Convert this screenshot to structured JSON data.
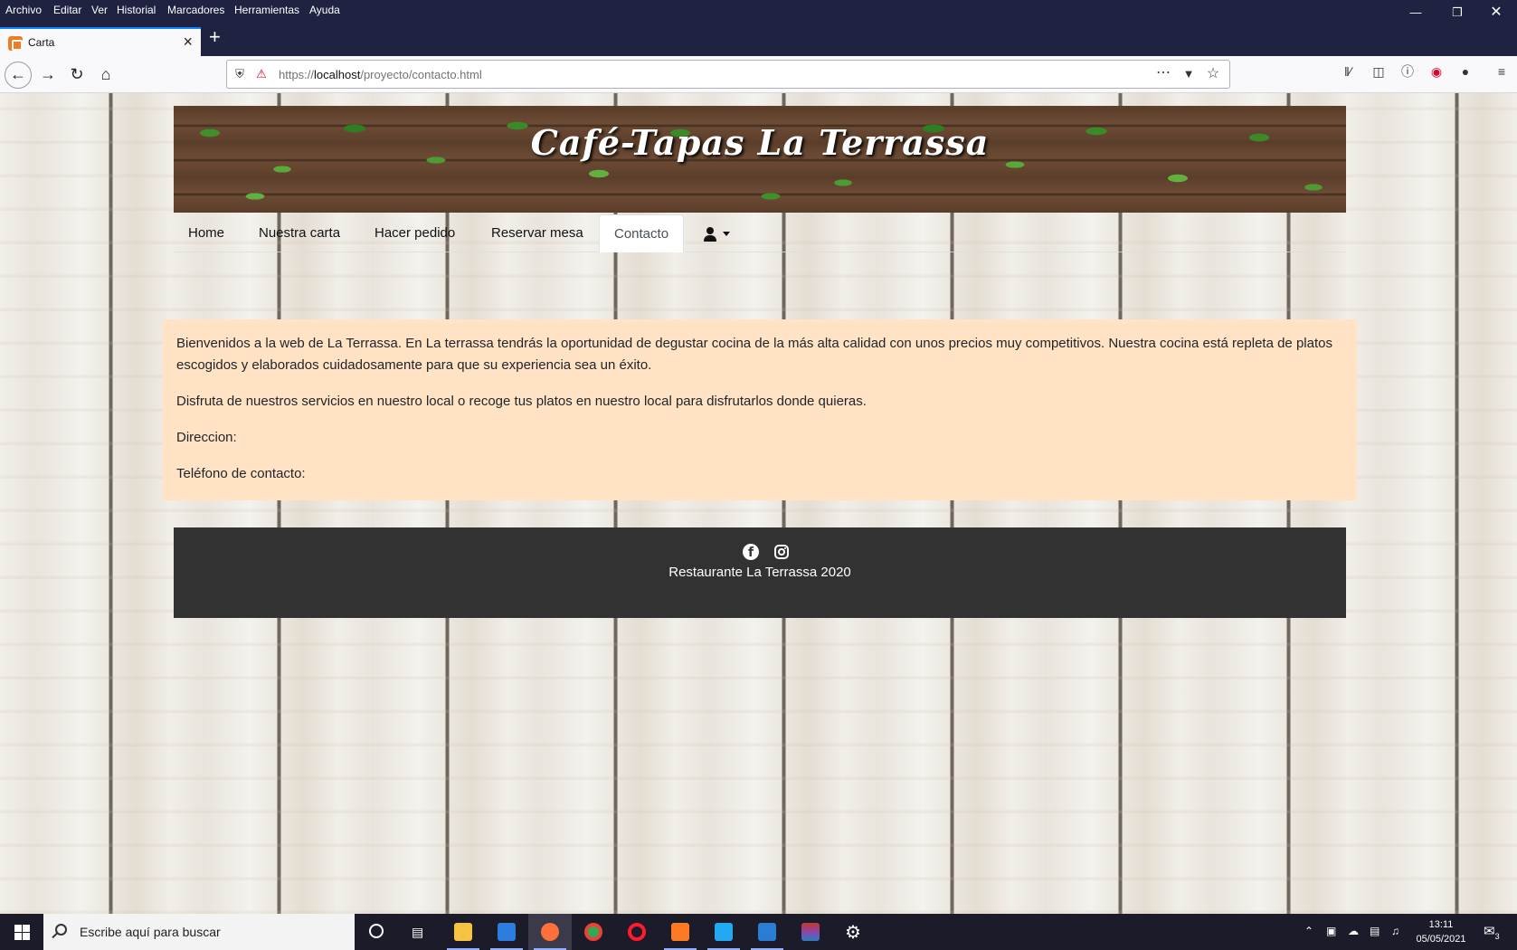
{
  "browser": {
    "menu": [
      "Archivo",
      "Editar",
      "Ver",
      "Historial",
      "Marcadores",
      "Herramientas",
      "Ayuda"
    ],
    "tab_title": "Carta",
    "url_prefix": "https://",
    "url_host": "localhost",
    "url_path": "/proyecto/contacto.html"
  },
  "site": {
    "title": "Café-Tapas La Terrassa",
    "nav": [
      "Home",
      "Nuestra carta",
      "Hacer pedido",
      "Reservar mesa",
      "Contacto"
    ],
    "active_nav": "Contacto",
    "content": {
      "p1": "Bienvenidos a la web de La Terrassa. En La terrassa tendrás la oportunidad de degustar cocina de la más alta calidad con unos precios muy competitivos. Nuestra cocina está repleta de platos escogidos y elaborados cuidadosamente para que su experiencia sea un éxito.",
      "p2": "Disfruta de nuestros servicios en nuestro local o recoge tus platos en nuestro local para disfrutarlos donde quieras.",
      "p3": "Direccion:",
      "p4": "Teléfono de contacto:"
    },
    "footer": "Restaurante La Terrassa 2020"
  },
  "taskbar": {
    "search_placeholder": "Escribe aquí para buscar",
    "time": "13:11",
    "date": "05/05/2021",
    "notifications": "3"
  },
  "colors": {
    "content_bg": "#ffe3c4",
    "footer_bg": "#333232",
    "chrome_dark": "#1f2241"
  }
}
